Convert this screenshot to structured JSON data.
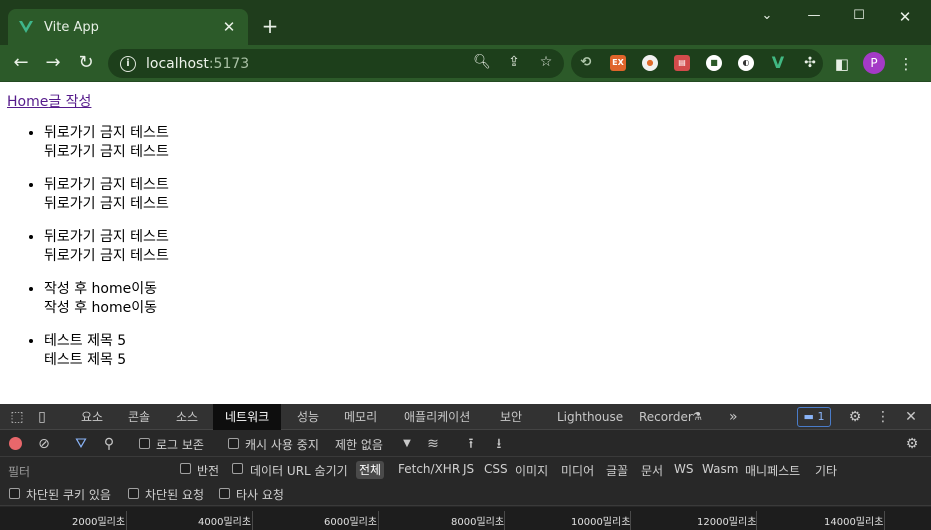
{
  "browser": {
    "tab_title": "Vite App",
    "url_host": "localhost",
    "url_port": ":5173",
    "avatar_letter": "P"
  },
  "page": {
    "links": [
      "Home",
      "글 작성"
    ],
    "items": [
      {
        "line1": "뒤로가기 금지 테스트",
        "line2": "뒤로가기 금지 테스트"
      },
      {
        "line1": "뒤로가기 금지 테스트",
        "line2": "뒤로가기 금지 테스트"
      },
      {
        "line1": "뒤로가기 금지 테스트",
        "line2": "뒤로가기 금지 테스트"
      },
      {
        "line1": "작성 후 home이동",
        "line2": "작성 후 home이동"
      },
      {
        "line1": "테스트 제목 5",
        "line2": "테스트 제목 5"
      }
    ]
  },
  "devtools": {
    "tabs": [
      "요소",
      "콘솔",
      "소스",
      "네트워크",
      "성능",
      "메모리",
      "애플리케이션",
      "보안",
      "Lighthouse",
      "Recorder",
      "»"
    ],
    "active_tab": "네트워크",
    "issues_count": "1",
    "toolbar": {
      "preserve_log": "로그 보존",
      "disable_cache": "캐시 사용 중지",
      "throttle": "제한 없음"
    },
    "filter": {
      "placeholder": "필터",
      "invert": "반전",
      "hide_data_urls": "데이터 URL 숨기기",
      "types": [
        "전체",
        "Fetch/XHR",
        "JS",
        "CSS",
        "이미지",
        "미디어",
        "글꼴",
        "문서",
        "WS",
        "Wasm",
        "매니페스트",
        "기타"
      ]
    },
    "options": [
      "차단된 쿠키 있음",
      "차단된 요청",
      "타사 요청"
    ],
    "timeline_ticks": [
      "2000밀리초",
      "4000밀리초",
      "6000밀리초",
      "8000밀리초",
      "10000밀리초",
      "12000밀리초",
      "14000밀리초"
    ]
  },
  "colors": {
    "frame": "#1f3d1c",
    "toolbar": "#2c5a29",
    "link": "#551a8b",
    "avatar": "#a43ac6",
    "record": "#e8676b"
  }
}
